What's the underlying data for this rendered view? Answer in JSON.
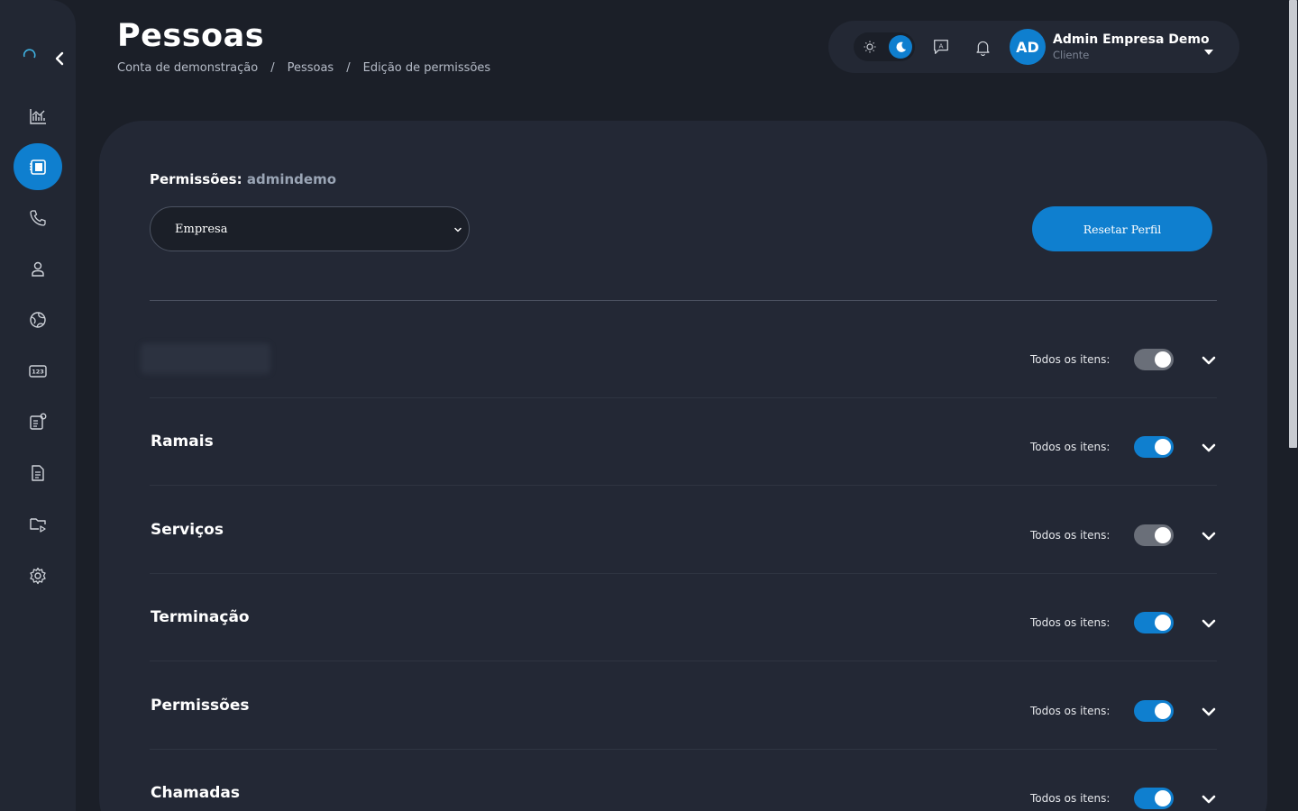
{
  "page": {
    "title": "Pessoas",
    "breadcrumb": [
      "Conta de demonstração",
      "Pessoas",
      "Edição de permissões"
    ],
    "breadcrumb_separator": "/"
  },
  "sidebar": {
    "items": [
      {
        "icon": "chart-icon",
        "active": false
      },
      {
        "icon": "contact-card-icon",
        "active": true
      },
      {
        "icon": "phone-icon",
        "active": false
      },
      {
        "icon": "user-icon",
        "active": false
      },
      {
        "icon": "globe-icon",
        "active": false
      },
      {
        "icon": "numbers-123-icon",
        "active": false
      },
      {
        "icon": "card-settings-icon",
        "active": false
      },
      {
        "icon": "document-icon",
        "active": false
      },
      {
        "icon": "folder-play-icon",
        "active": false
      },
      {
        "icon": "gear-icon",
        "active": false
      }
    ]
  },
  "topbar": {
    "avatar_initials": "AD",
    "user_name": "Admin Empresa Demo",
    "user_role": "Cliente",
    "theme": "dark"
  },
  "permissions": {
    "label": "Permissões:",
    "username": "admindemo",
    "select_value": "Empresa",
    "reset_label": "Resetar Perfil",
    "rows": [
      {
        "title": "",
        "blurred": true,
        "todos_label": "Todos os itens:",
        "enabled": false
      },
      {
        "title": "Ramais",
        "blurred": false,
        "todos_label": "Todos os itens:",
        "enabled": true
      },
      {
        "title": "Serviços",
        "blurred": false,
        "todos_label": "Todos os itens:",
        "enabled": false
      },
      {
        "title": "Terminação",
        "blurred": false,
        "todos_label": "Todos os itens:",
        "enabled": true
      },
      {
        "title": "Permissões",
        "blurred": false,
        "todos_label": "Todos os itens:",
        "enabled": true
      },
      {
        "title": "Chamadas",
        "blurred": false,
        "todos_label": "Todos os itens:",
        "enabled": true
      }
    ]
  },
  "colors": {
    "accent": "#0f7fcf",
    "background": "#1b1f28",
    "card": "#232835",
    "toggle_off": "#6a6f79"
  }
}
